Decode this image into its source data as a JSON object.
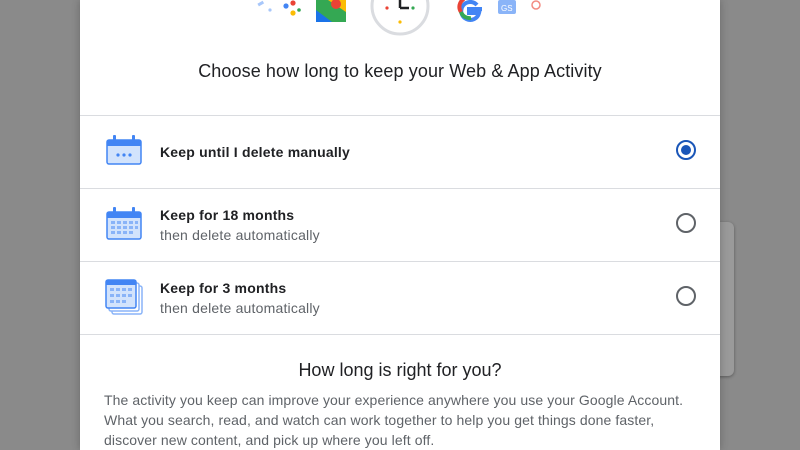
{
  "dialog": {
    "title": "Choose how long to keep your Web & App Activity",
    "hero_icons": [
      "assistant-icon",
      "maps-icon",
      "clock-icon",
      "google-logo-icon",
      "news-icon"
    ]
  },
  "options": [
    {
      "title": "Keep until I delete manually",
      "subtitle": "",
      "selected": true,
      "icon": "calendar-single-icon"
    },
    {
      "title": "Keep for 18 months",
      "subtitle": "then delete automatically",
      "selected": false,
      "icon": "calendar-grid-icon"
    },
    {
      "title": "Keep for 3 months",
      "subtitle": "then delete automatically",
      "selected": false,
      "icon": "calendar-stack-icon"
    }
  ],
  "info": {
    "title": "How long is right for you?",
    "body": "The activity you keep can improve your experience anywhere you use your Google Account. What you search, read, and watch can work together to help you get things done faster, discover new content, and pick up where you left off."
  },
  "colors": {
    "accent": "#1a56b8",
    "icon_blue": "#4285f4",
    "icon_light": "#d2e3fc"
  }
}
